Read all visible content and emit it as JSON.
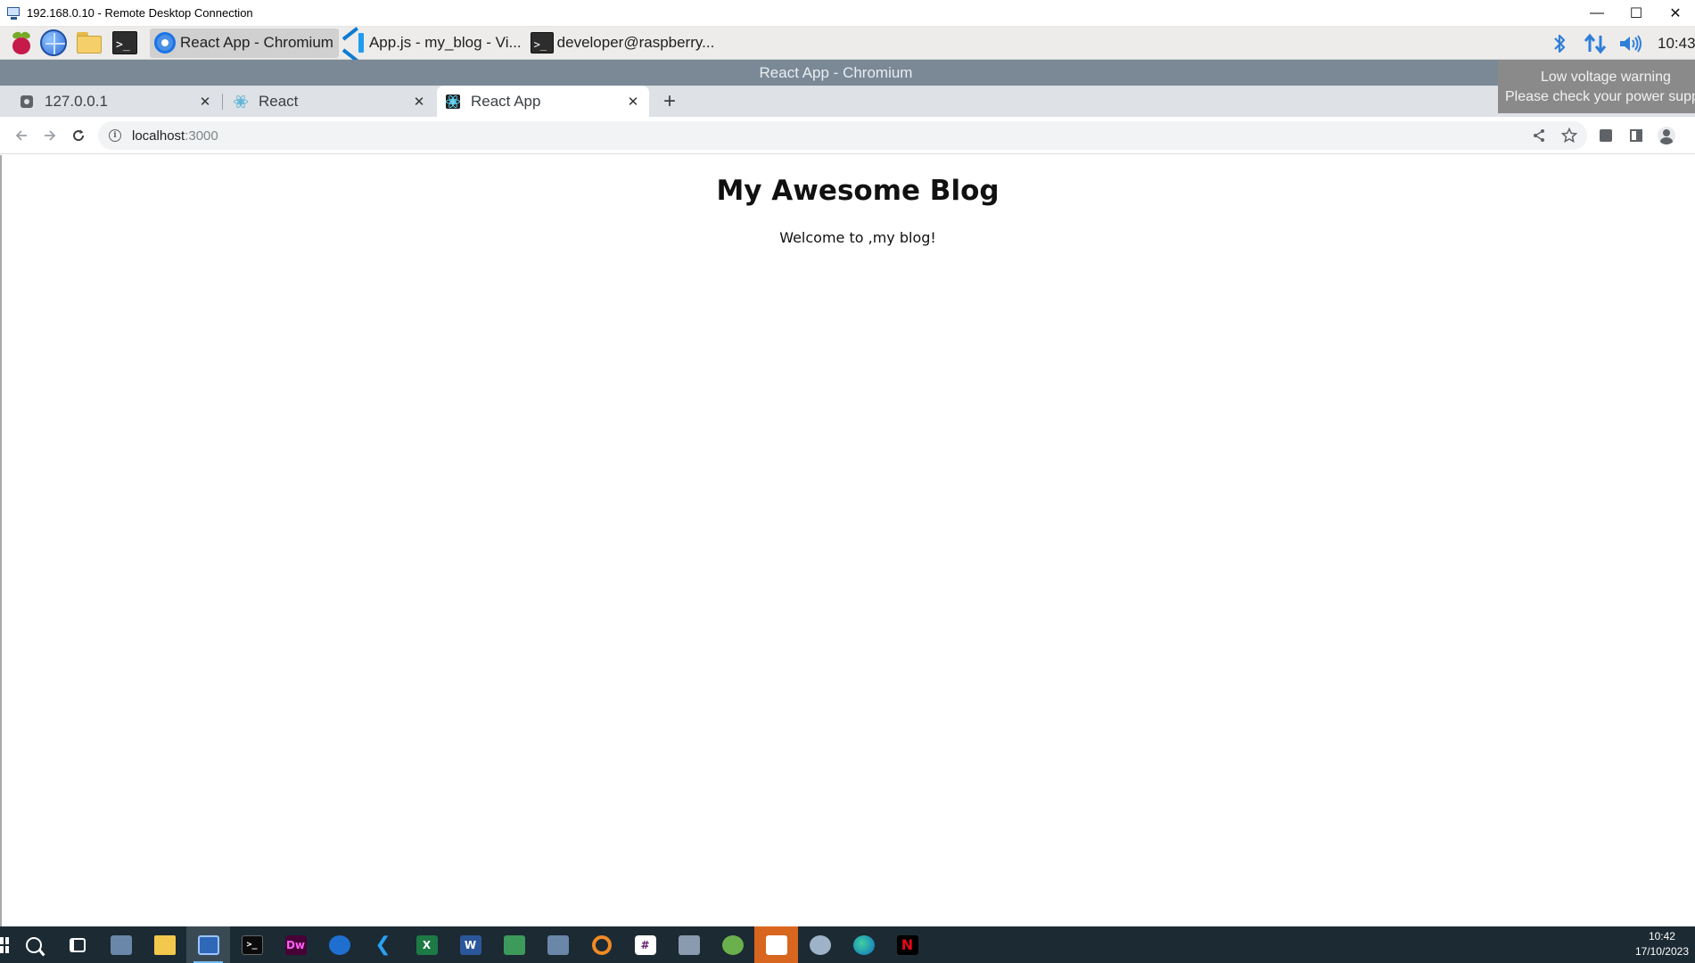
{
  "rdp": {
    "title": "192.168.0.10 - Remote Desktop Connection",
    "minimize": "—",
    "maximize": "☐",
    "close": "✕"
  },
  "pi_panel": {
    "tasks": [
      {
        "label": "React App - Chromium",
        "icon": "chromium-icon",
        "active": true
      },
      {
        "label": "App.js - my_blog - Vi...",
        "icon": "vscode-icon",
        "active": false
      },
      {
        "label": "developer@raspberry...",
        "icon": "terminal-icon",
        "active": false
      }
    ],
    "clock": "10:43",
    "terminal_prompt": ">_"
  },
  "chrome": {
    "window_title": "React App - Chromium",
    "tabs": [
      {
        "label": "127.0.0.1",
        "favicon": "gear-favicon",
        "active": false
      },
      {
        "label": "React",
        "favicon": "react-favicon",
        "active": false
      },
      {
        "label": "React App",
        "favicon": "react-app-favicon",
        "active": true
      }
    ],
    "tab_close": "✕",
    "new_tab": "+",
    "url_host": "localhost",
    "url_port": ":3000",
    "info_icon": "i"
  },
  "tooltip": {
    "line1": "Low voltage warning",
    "line2": "Please check your power supp"
  },
  "page": {
    "heading": "My Awesome Blog",
    "subtitle": "Welcome to ,my blog!"
  },
  "taskbar": {
    "time": "10:42",
    "date": "17/10/2023",
    "labels": {
      "terminal": ">_",
      "dreamweaver": "Dw",
      "excel": "X",
      "word": "W",
      "netflix": "N"
    }
  },
  "colors": {
    "pi_tray_blue": "#2f7fd8",
    "chrome_title_bg": "#7b8996",
    "taskbar_bg": "#1c2a33",
    "tooltip_bg": "#8a8a8a"
  }
}
